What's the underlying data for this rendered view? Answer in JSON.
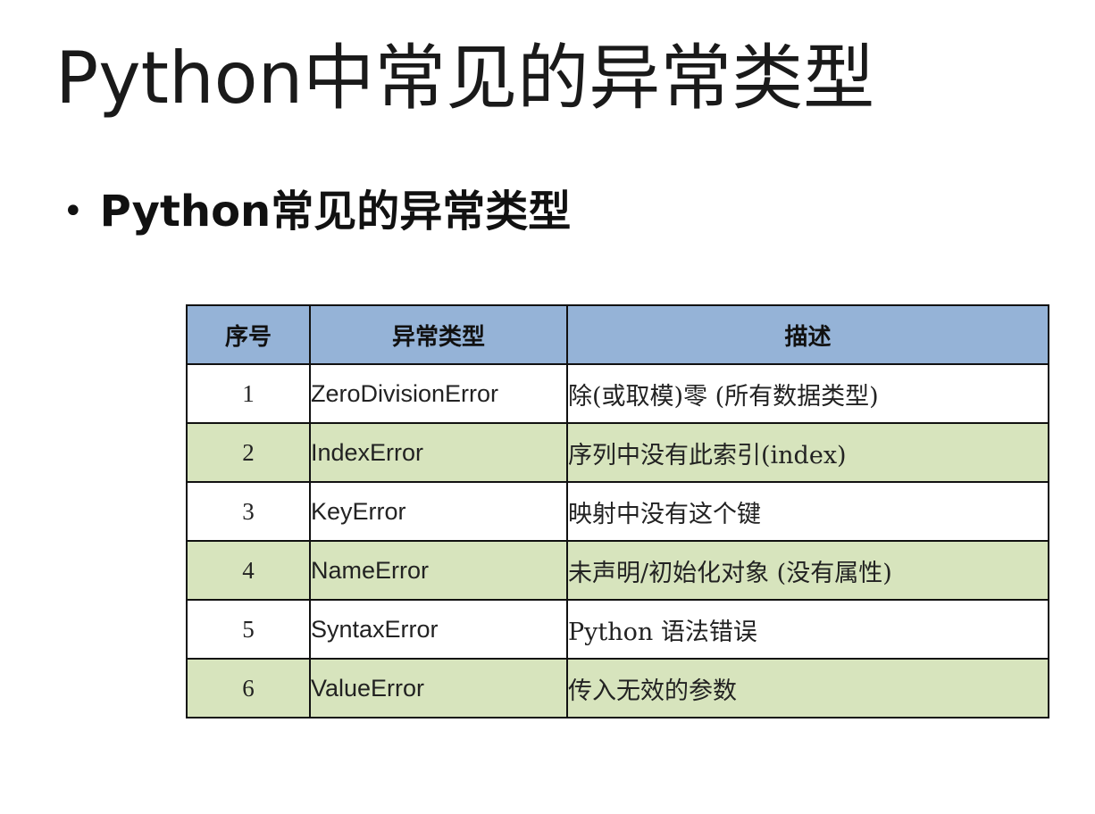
{
  "slide": {
    "title": "Python中常见的异常类型",
    "bullet": "Python常见的异常类型"
  },
  "table": {
    "headers": {
      "no": "序号",
      "type": "异常类型",
      "desc": "描述"
    },
    "rows": [
      {
        "no": "1",
        "type": "ZeroDivisionError",
        "desc": "除(或取模)零 (所有数据类型)"
      },
      {
        "no": "2",
        "type": "IndexError",
        "desc": "序列中没有此索引(index)"
      },
      {
        "no": "3",
        "type": "KeyError",
        "desc": "映射中没有这个键"
      },
      {
        "no": "4",
        "type": "NameError",
        "desc": "未声明/初始化对象 (没有属性)"
      },
      {
        "no": "5",
        "type": "SyntaxError",
        "desc": "Python 语法错误"
      },
      {
        "no": "6",
        "type": "ValueError",
        "desc": "传入无效的参数"
      }
    ],
    "colors": {
      "header": "#95b3d7",
      "row_alt": "#d7e4bd",
      "row": "#ffffff"
    }
  }
}
